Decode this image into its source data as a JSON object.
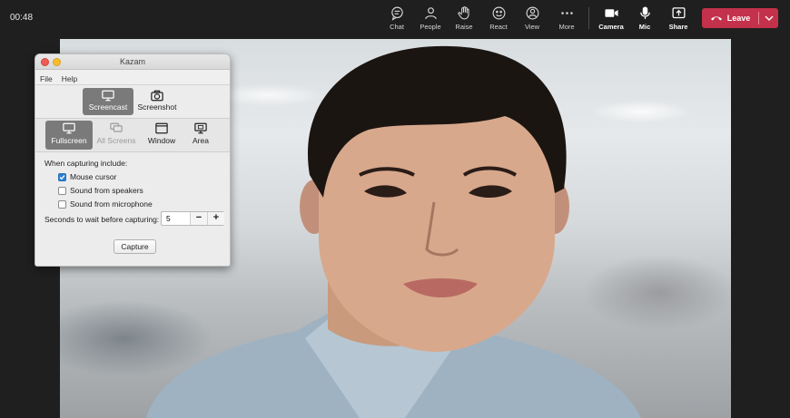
{
  "meeting": {
    "timer": "00:48",
    "controls": [
      {
        "id": "chat",
        "label": "Chat",
        "icon": "chat-icon"
      },
      {
        "id": "people",
        "label": "People",
        "icon": "people-icon"
      },
      {
        "id": "raise",
        "label": "Raise",
        "icon": "raise-hand-icon"
      },
      {
        "id": "react",
        "label": "React",
        "icon": "smiley-icon"
      },
      {
        "id": "view",
        "label": "View",
        "icon": "view-icon"
      },
      {
        "id": "more",
        "label": "More",
        "icon": "more-icon"
      }
    ],
    "devices": [
      {
        "id": "camera",
        "label": "Camera",
        "icon": "camera-icon"
      },
      {
        "id": "mic",
        "label": "Mic",
        "icon": "mic-icon"
      },
      {
        "id": "share",
        "label": "Share",
        "icon": "share-icon"
      }
    ],
    "leave_label": "Leave",
    "colors": {
      "leave": "#c4314b",
      "toolbar_bg": "#1f1f1f"
    }
  },
  "kazam": {
    "title": "Kazam",
    "menu": [
      "File",
      "Help"
    ],
    "modes": [
      {
        "label": "Screencast",
        "active": true
      },
      {
        "label": "Screenshot",
        "active": false
      }
    ],
    "sources": [
      {
        "label": "Fullscreen",
        "active": true
      },
      {
        "label": "All Screens",
        "disabled": true
      },
      {
        "label": "Window"
      },
      {
        "label": "Area"
      }
    ],
    "options_heading": "When capturing include:",
    "options": [
      {
        "label": "Mouse cursor",
        "checked": true
      },
      {
        "label": "Sound from speakers",
        "checked": false
      },
      {
        "label": "Sound from microphone",
        "checked": false
      }
    ],
    "wait_label": "Seconds to wait before capturing:",
    "wait_value": "5",
    "minus": "−",
    "plus": "+",
    "capture_label": "Capture",
    "colors": {
      "checkbox_on": "#2f7fd1",
      "selected_bg": "#7a7a7a"
    }
  }
}
